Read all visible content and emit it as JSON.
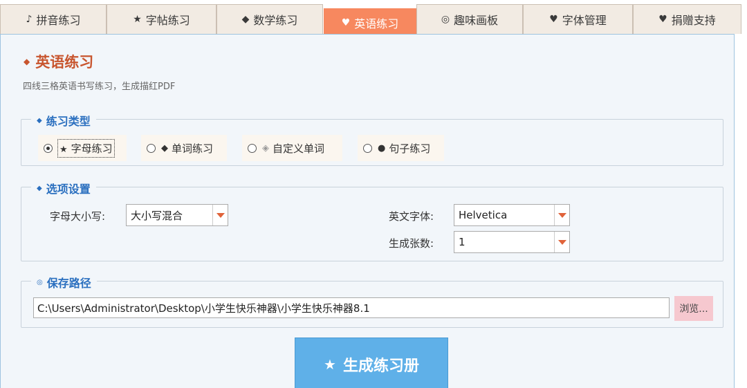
{
  "tabs": [
    {
      "icon": "♪",
      "label": "拼音练习"
    },
    {
      "icon": "★",
      "label": "字帖练习"
    },
    {
      "icon": "◆",
      "label": "数学练习"
    },
    {
      "icon": "♥",
      "label": "英语练习"
    },
    {
      "icon": "◎",
      "label": "趣味画板"
    },
    {
      "icon": "♥",
      "label": "字体管理"
    },
    {
      "icon": "♥",
      "label": "捐赠支持"
    }
  ],
  "active_tab": "英语练习",
  "page": {
    "title_icon": "◆",
    "title": "英语练习",
    "subtitle": "四线三格英语书写练习，生成描红PDF"
  },
  "practice_type": {
    "legend_icon": "◆",
    "legend": "练习类型",
    "options": [
      {
        "icon": "★",
        "label": "字母练习",
        "checked": true
      },
      {
        "icon": "◆",
        "label": "单词练习",
        "checked": false
      },
      {
        "icon": "◈",
        "label": "自定义单词",
        "checked": false
      },
      {
        "icon": "●",
        "label": "句子练习",
        "checked": false
      }
    ]
  },
  "options": {
    "legend_icon": "◆",
    "legend": "选项设置",
    "case_label": "字母大小写:",
    "case_value": "大小写混合",
    "font_label": "英文字体:",
    "font_value": "Helvetica",
    "count_label": "生成张数:",
    "count_value": "1"
  },
  "save": {
    "legend_icon": "◎",
    "legend": "保存路径",
    "path": "C:\\Users\\Administrator\\Desktop\\小学生快乐神器\\小学生快乐神器8.1",
    "browse_label": "浏览..."
  },
  "generate": {
    "icon": "★",
    "label": "生成练习册"
  },
  "colors": {
    "accent_tab": "#f7885f",
    "title": "#c8552e",
    "legend": "#2a6fbf",
    "generate_button": "#5fb0e8",
    "browse_button": "#f6c8cf"
  }
}
